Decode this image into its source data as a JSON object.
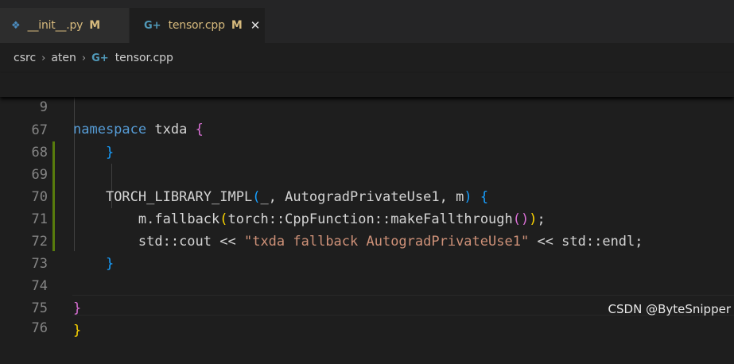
{
  "tabs": [
    {
      "label": "__init__.py",
      "status": "M",
      "icon": "python-icon",
      "active": false
    },
    {
      "label": "tensor.cpp",
      "status": "M",
      "icon": "cpp-icon",
      "active": true,
      "close": "✕"
    }
  ],
  "breadcrumb": {
    "items": [
      "csrc",
      "aten",
      "tensor.cpp"
    ],
    "separator": "›"
  },
  "sticky": {
    "line_number": "9",
    "keyword": "namespace",
    "name": "txda",
    "brace": "{"
  },
  "code_lines": [
    {
      "num": "67"
    },
    {
      "num": "68"
    },
    {
      "num": "69"
    },
    {
      "num": "70"
    },
    {
      "num": "71"
    },
    {
      "num": "72"
    },
    {
      "num": "73"
    },
    {
      "num": "74"
    },
    {
      "num": "75"
    },
    {
      "num": "76"
    }
  ],
  "code": {
    "l67": {
      "brace": "}"
    },
    "l69": {
      "macro": "TORCH_LIBRARY_IMPL",
      "open": "(",
      "args": "_, AutogradPrivateUse1, m",
      "close": ")",
      "brace": "{"
    },
    "l70": {
      "obj": "m",
      "dot": ".",
      "method": "fallback",
      "open": "(",
      "ns": "torch::CppFunction::",
      "fn": "makeFallthrough",
      "inner": "()",
      "close": ")",
      "semi": ";"
    },
    "l71": {
      "std": "std::cout",
      "op": " << ",
      "str": "\"txda fallback AutogradPrivateUse1\"",
      "op2": " << ",
      "endl": "std::endl",
      "semi": ";"
    },
    "l72": {
      "brace": "}"
    },
    "l74": {
      "brace": "}"
    },
    "l75": {
      "brace": "}"
    }
  },
  "watermark": "CSDN @ByteSnipper",
  "colors": {
    "editor_bg": "#1e1e1e",
    "keyword": "#569cd6",
    "function": "#dcdcaa",
    "string": "#ce9178",
    "modified": "#d7ba7d",
    "git_added": "#587c0c"
  }
}
